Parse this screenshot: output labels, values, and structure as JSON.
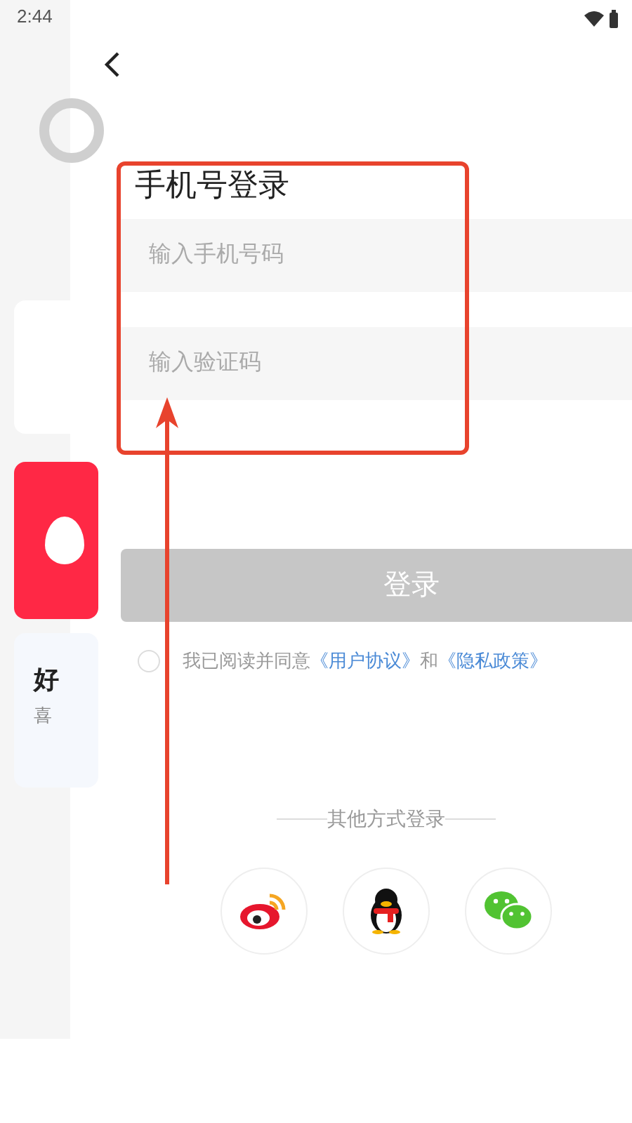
{
  "status_bar": {
    "time": "2:44"
  },
  "background_app": {
    "card_title": "好",
    "card_subtitle": "喜"
  },
  "login": {
    "title": "手机号登录",
    "phone_field": {
      "placeholder": "输入手机号码"
    },
    "code_field": {
      "placeholder": "输入验证码"
    },
    "submit": {
      "label": "登录",
      "disabled": true
    },
    "agreement": {
      "checked": false,
      "parts": [
        {
          "kind": "text",
          "text": "我已阅读并同意"
        },
        {
          "kind": "link",
          "text": "《用户协议》"
        },
        {
          "kind": "text",
          "text": "和"
        },
        {
          "kind": "link",
          "text": "《隐私政策》"
        }
      ]
    },
    "other_methods": {
      "label": "其他方式登录",
      "providers": [
        {
          "kind": "weibo"
        },
        {
          "kind": "qq"
        },
        {
          "kind": "wechat"
        }
      ]
    }
  }
}
